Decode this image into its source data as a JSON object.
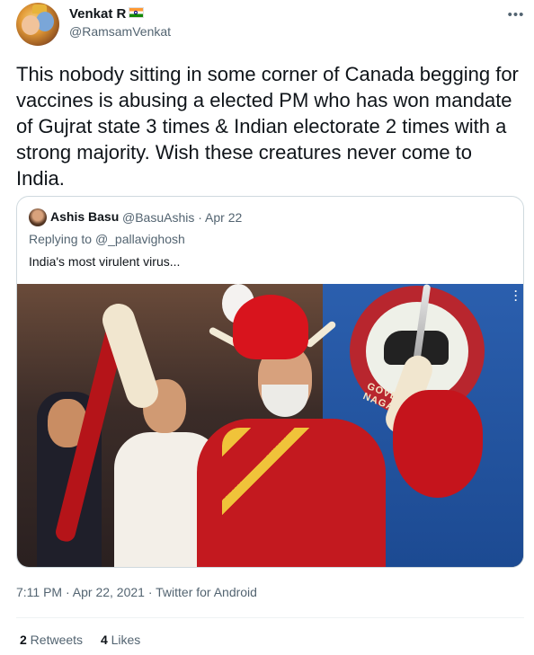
{
  "author": {
    "name": "Venkat R",
    "handle": "@RamsamVenkat"
  },
  "more_button": "•••",
  "tweet_text": "This nobody sitting in some corner of Canada begging for vaccines is abusing a elected PM who has won mandate of Gujrat state 3 times & Indian electorate 2 times with a strong majority. Wish these creatures never come to India.",
  "quoted": {
    "name": "Ashis Basu",
    "handle_time": "@BasuAshis · Apr 22",
    "reply_prefix": "Replying to ",
    "reply_mention": "@_pallavighosh",
    "text": "India's most virulent virus...",
    "photo_seal_text": "GOVERNMENT OF NAGALAND"
  },
  "meta": {
    "timestamp": "7:11 PM · Apr 22, 2021 · Twitter for Android"
  },
  "stats": {
    "retweets_count": "2",
    "retweets_label": " Retweets",
    "likes_count": "4",
    "likes_label": " Likes"
  },
  "colors": {
    "text_primary": "#0f1419",
    "text_secondary": "#536471",
    "border": "#cfd9de"
  }
}
